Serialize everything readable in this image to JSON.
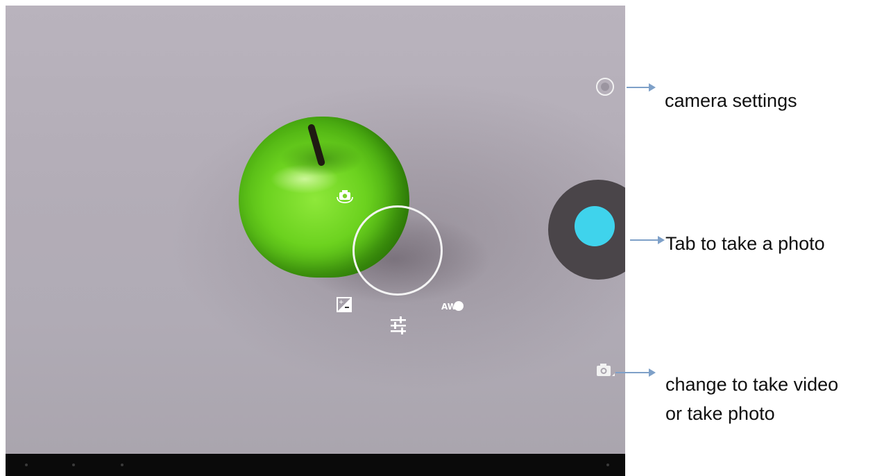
{
  "viewfinder": {
    "subject": "green apple",
    "icons": {
      "switch_camera": "switch-camera-icon",
      "exposure": "exposure-icon",
      "settings_sliders": "sliders-icon",
      "white_balance": "awb-icon",
      "awb_label": "AW"
    }
  },
  "controls": {
    "settings_icon": "circle-settings-icon",
    "shutter_icon": "shutter-icon",
    "mode_switch_icon": "camera-mode-icon"
  },
  "annotations": {
    "settings_label": "camera settings",
    "shutter_label": "Tab to take a photo",
    "mode_label_line1": "change to take video",
    "mode_label_line2": "or take photo"
  },
  "colors": {
    "shutter": "#3fd3ec",
    "shutter_ring": "#4a4549",
    "arrow": "#7ea0c8"
  }
}
